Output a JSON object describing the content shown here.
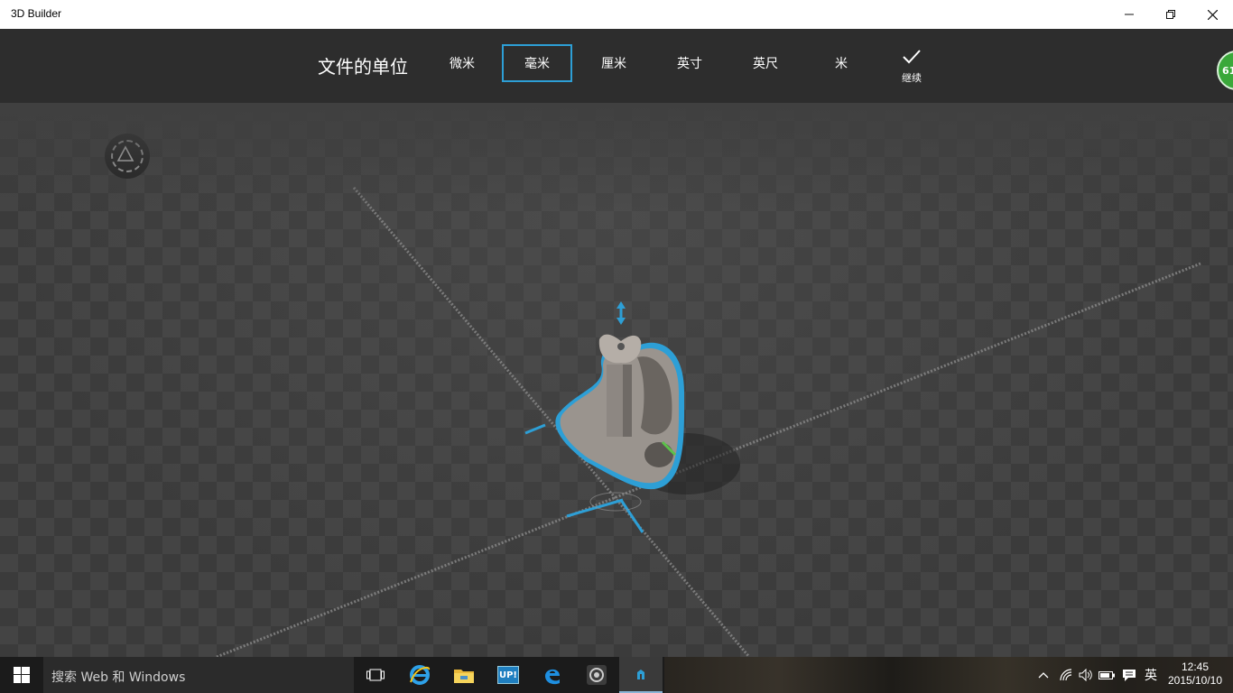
{
  "window": {
    "title": "3D Builder"
  },
  "toolbar": {
    "title": "文件的单位",
    "units": [
      "微米",
      "毫米",
      "厘米",
      "英寸",
      "英尺",
      "米"
    ],
    "selected_unit": "毫米",
    "continue_label": "继续",
    "badge_text": "61"
  },
  "viewport": {
    "nav_icon": "view-cube-icon"
  },
  "taskbar": {
    "search_placeholder": "搜索 Web 和 Windows",
    "apps": [
      "task-view-icon",
      "internet-explorer-icon",
      "file-explorer-icon",
      "up-app-icon",
      "edge-icon",
      "3d-app-icon",
      "3d-builder-icon"
    ],
    "up_label": "UP!",
    "ime": "英",
    "time": "12:45",
    "date": "2015/10/10"
  },
  "colors": {
    "accent": "#2d9fd6",
    "toolbar_bg": "#2d2d2d",
    "badge": "#3aa83a"
  }
}
